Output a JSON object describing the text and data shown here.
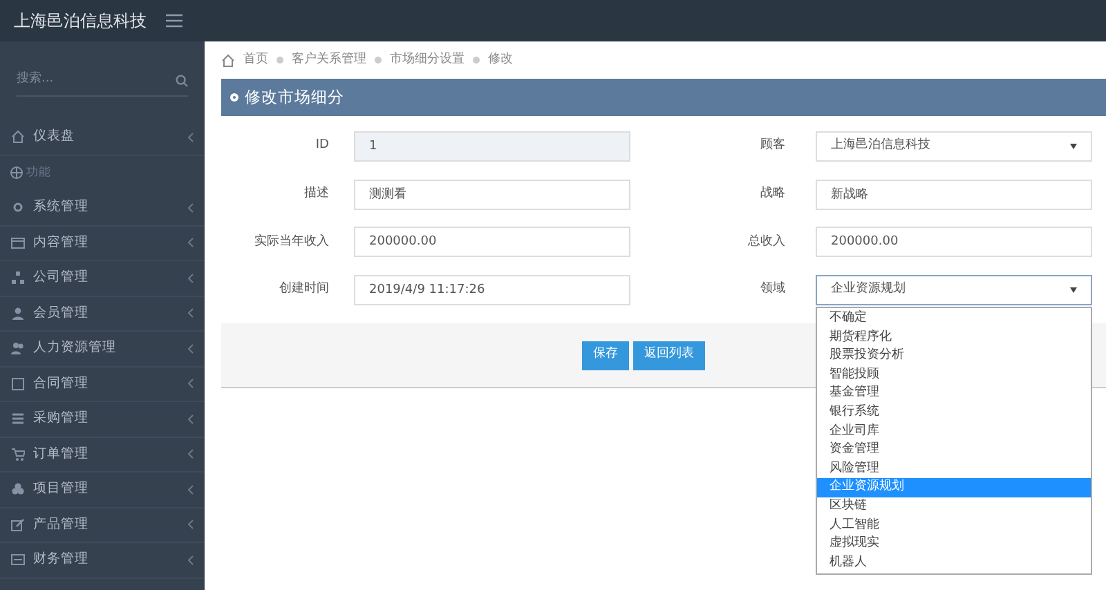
{
  "brand": "上海邑泊信息科技",
  "sidebar": {
    "search": {
      "placeholder": "搜索..."
    },
    "items": [
      {
        "kind": "item",
        "label": "仪表盘"
      },
      {
        "kind": "header",
        "label": "功能"
      },
      {
        "kind": "item",
        "label": "系统管理"
      },
      {
        "kind": "item",
        "label": "内容管理"
      },
      {
        "kind": "item",
        "label": "公司管理"
      },
      {
        "kind": "item",
        "label": "会员管理"
      },
      {
        "kind": "item",
        "label": "人力资源管理"
      },
      {
        "kind": "item",
        "label": "合同管理"
      },
      {
        "kind": "item",
        "label": "采购管理"
      },
      {
        "kind": "item",
        "label": "订单管理"
      },
      {
        "kind": "item",
        "label": "项目管理"
      },
      {
        "kind": "item",
        "label": "产品管理"
      },
      {
        "kind": "item",
        "label": "财务管理"
      }
    ]
  },
  "breadcrumb": [
    "首页",
    "客户关系管理",
    "市场细分设置",
    "修改"
  ],
  "panel_title": "修改市场细分",
  "fields": [
    {
      "label": "ID",
      "kind": "text",
      "value": "1",
      "disabled": true
    },
    {
      "label": "顾客",
      "kind": "select",
      "value": "上海邑泊信息科技"
    },
    {
      "label": "描述",
      "kind": "text",
      "value": "测测看",
      "disabled": false
    },
    {
      "label": "战略",
      "kind": "text",
      "value": "新战略",
      "disabled": false
    },
    {
      "label": "实际当年收入",
      "kind": "text",
      "value": "200000.00",
      "disabled": false
    },
    {
      "label": "总收入",
      "kind": "text",
      "value": "200000.00",
      "disabled": false
    },
    {
      "label": "创建时间",
      "kind": "text",
      "value": "2019/4/9 11:17:26",
      "disabled": false
    },
    {
      "label": "领域",
      "kind": "select",
      "value": "企业资源规划",
      "expanded": true,
      "options": [
        {
          "label": "不确定",
          "selected": false
        },
        {
          "label": "期货程序化",
          "selected": false
        },
        {
          "label": "股票投资分析",
          "selected": false
        },
        {
          "label": "智能投顾",
          "selected": false
        },
        {
          "label": "基金管理",
          "selected": false
        },
        {
          "label": "银行系统",
          "selected": false
        },
        {
          "label": "企业司库",
          "selected": false
        },
        {
          "label": "资金管理",
          "selected": false
        },
        {
          "label": "风险管理",
          "selected": false
        },
        {
          "label": "企业资源规划",
          "selected": true
        },
        {
          "label": "区块链",
          "selected": false
        },
        {
          "label": "人工智能",
          "selected": false
        },
        {
          "label": "虚拟现实",
          "selected": false
        },
        {
          "label": "机器人",
          "selected": false
        }
      ]
    }
  ],
  "buttons": [
    "保存",
    "返回列表"
  ]
}
